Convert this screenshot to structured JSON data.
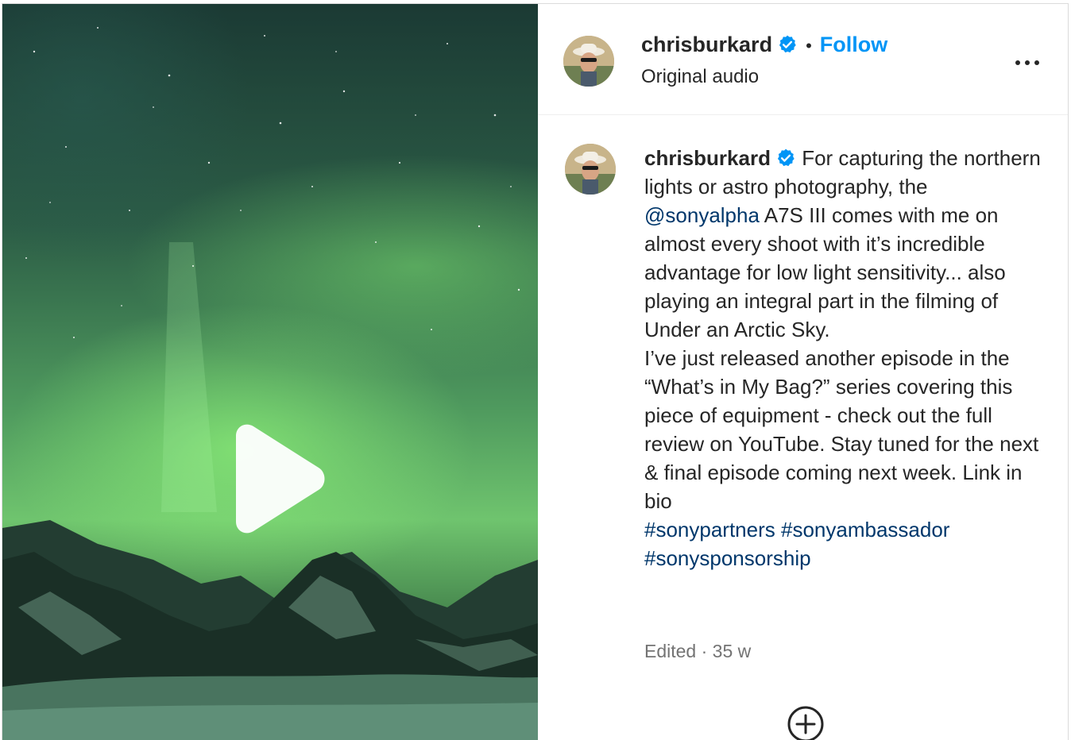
{
  "post": {
    "username": "chrisburkard",
    "follow_label": "Follow",
    "separator": "•",
    "audio_label": "Original audio",
    "more_label": "More options",
    "caption": {
      "username": "chrisburkard",
      "text_1": "For capturing the northern lights or astro photography, the",
      "mention": "@sonyalpha",
      "text_2": "A7S III comes with me on almost every shoot with it’s incredible advantage for low light sensitivity... also playing an integral part in the filming of Under an Arctic Sky.",
      "text_3": "I’ve just released another episode in the “What’s in My Bag?” series covering this piece of equipment - check out the full review on YouTube. Stay tuned for the next & final episode coming next week. Link in bio",
      "hashtags": [
        "#sonypartners",
        "#sonyambassador",
        "#sonysponsorship"
      ]
    },
    "meta": "Edited · 35 w"
  },
  "icons": {
    "verified": "verified-badge-icon",
    "more": "more-horizontal-icon",
    "play": "play-icon",
    "add": "add-circle-icon"
  },
  "colors": {
    "follow": "#0095f6",
    "link": "#00376b",
    "verified": "#0095f6",
    "meta": "#737373"
  }
}
